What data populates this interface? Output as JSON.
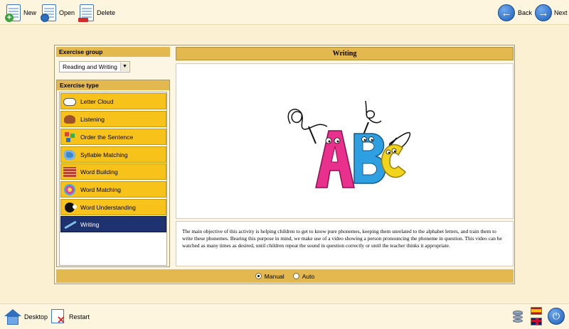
{
  "toolbar": {
    "new_label": "New",
    "open_label": "Open",
    "delete_label": "Delete",
    "back_label": "Back",
    "next_label": "Next"
  },
  "exercise_group": {
    "header": "Exercise group",
    "selected": "Reading and Writing"
  },
  "exercise_type": {
    "header": "Exercise type",
    "items": [
      {
        "label": "Letter Cloud",
        "icon": "cloud-icon"
      },
      {
        "label": "Listening",
        "icon": "ear-icon"
      },
      {
        "label": "Order the Sentence",
        "icon": "blocks-icon"
      },
      {
        "label": "Syllable Matching",
        "icon": "splash-icon"
      },
      {
        "label": "Word Building",
        "icon": "bricks-icon"
      },
      {
        "label": "Word Matching",
        "icon": "flower-icon"
      },
      {
        "label": "Word Understanding",
        "icon": "head-icon"
      },
      {
        "label": "Writing",
        "icon": "pen-icon",
        "selected": true
      }
    ]
  },
  "detail": {
    "title": "Writing",
    "description": "The main objective of this activity is helping children to get to know pure phonemes, keeping them unrelated to the alphabet letters, and train them to write these phonemes. Bearing this purpose in mind, we make use of a video showing a person pronouncing the phoneme in question. This video can be watched as many times as desired, until children repeat the sound in question correctly or until the teacher thinks it appropriate.",
    "illustration": {
      "letters": [
        "A",
        "B",
        "C"
      ],
      "handwritten": [
        "a",
        "b"
      ],
      "colors": [
        "#e8308c",
        "#2e9fe0",
        "#f2d41c"
      ]
    }
  },
  "mode": {
    "options": [
      {
        "label": "Manual",
        "selected": true
      },
      {
        "label": "Auto",
        "selected": false
      }
    ]
  },
  "footer": {
    "desktop_label": "Desktop",
    "restart_label": "Restart"
  }
}
